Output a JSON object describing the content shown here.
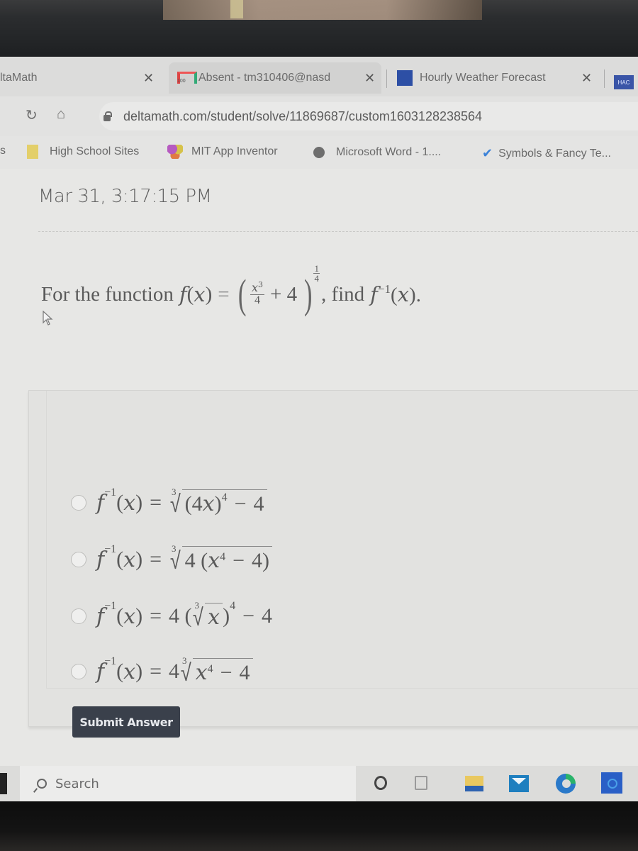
{
  "browser": {
    "tabs": [
      {
        "label": "ltaMath",
        "favicon": "deltamath-icon",
        "active": false
      },
      {
        "label": "Absent - tm310406@nasd",
        "favicon": "gmail-icon",
        "active": true
      },
      {
        "label": "Hourly Weather Forecast",
        "favicon": "weather-channel-icon",
        "active": false
      }
    ],
    "pinned_tab_label": "HAC",
    "close_glyph": "✕",
    "url": "deltamath.com/student/solve/11869687/custom1603128238564",
    "bookmarks": [
      {
        "label": "High School Sites",
        "icon": "folder-icon"
      },
      {
        "label": "MIT App Inventor",
        "icon": "mit-app-inventor-icon"
      },
      {
        "label": "Microsoft Word - 1....",
        "icon": "globe-icon"
      },
      {
        "label": "Symbols & Fancy Te...",
        "icon": "checkmark-icon"
      }
    ],
    "bookmark_edge_label": "s"
  },
  "page": {
    "timestamp": "Mar 31, 3:17:15 PM",
    "question": {
      "prefix": "For the function",
      "function_text": "f(x) = (x³/4 + 4)^(1/4)",
      "suffix": ", find",
      "target": "f⁻¹(x)."
    },
    "choices": [
      {
        "text": "f⁻¹(x) = ∛((4x)⁴ − 4)",
        "selected": false
      },
      {
        "text": "f⁻¹(x) = ∛(4(x⁴ − 4))",
        "selected": false
      },
      {
        "text": "f⁻¹(x) = 4(∛x)⁴ − 4",
        "selected": false
      },
      {
        "text": "f⁻¹(x) = 4∛(x⁴ − 4)",
        "selected": false
      }
    ],
    "submit_label": "Submit Answer"
  },
  "taskbar": {
    "search_placeholder": "Search",
    "pinned": [
      "cortana-icon",
      "task-view-icon",
      "file-explorer-icon",
      "mail-icon",
      "edge-icon",
      "store-icon"
    ]
  },
  "colors": {
    "submit_bg": "#3a404b",
    "page_bg": "#e7e7e5",
    "text": "#5a5a5a"
  }
}
